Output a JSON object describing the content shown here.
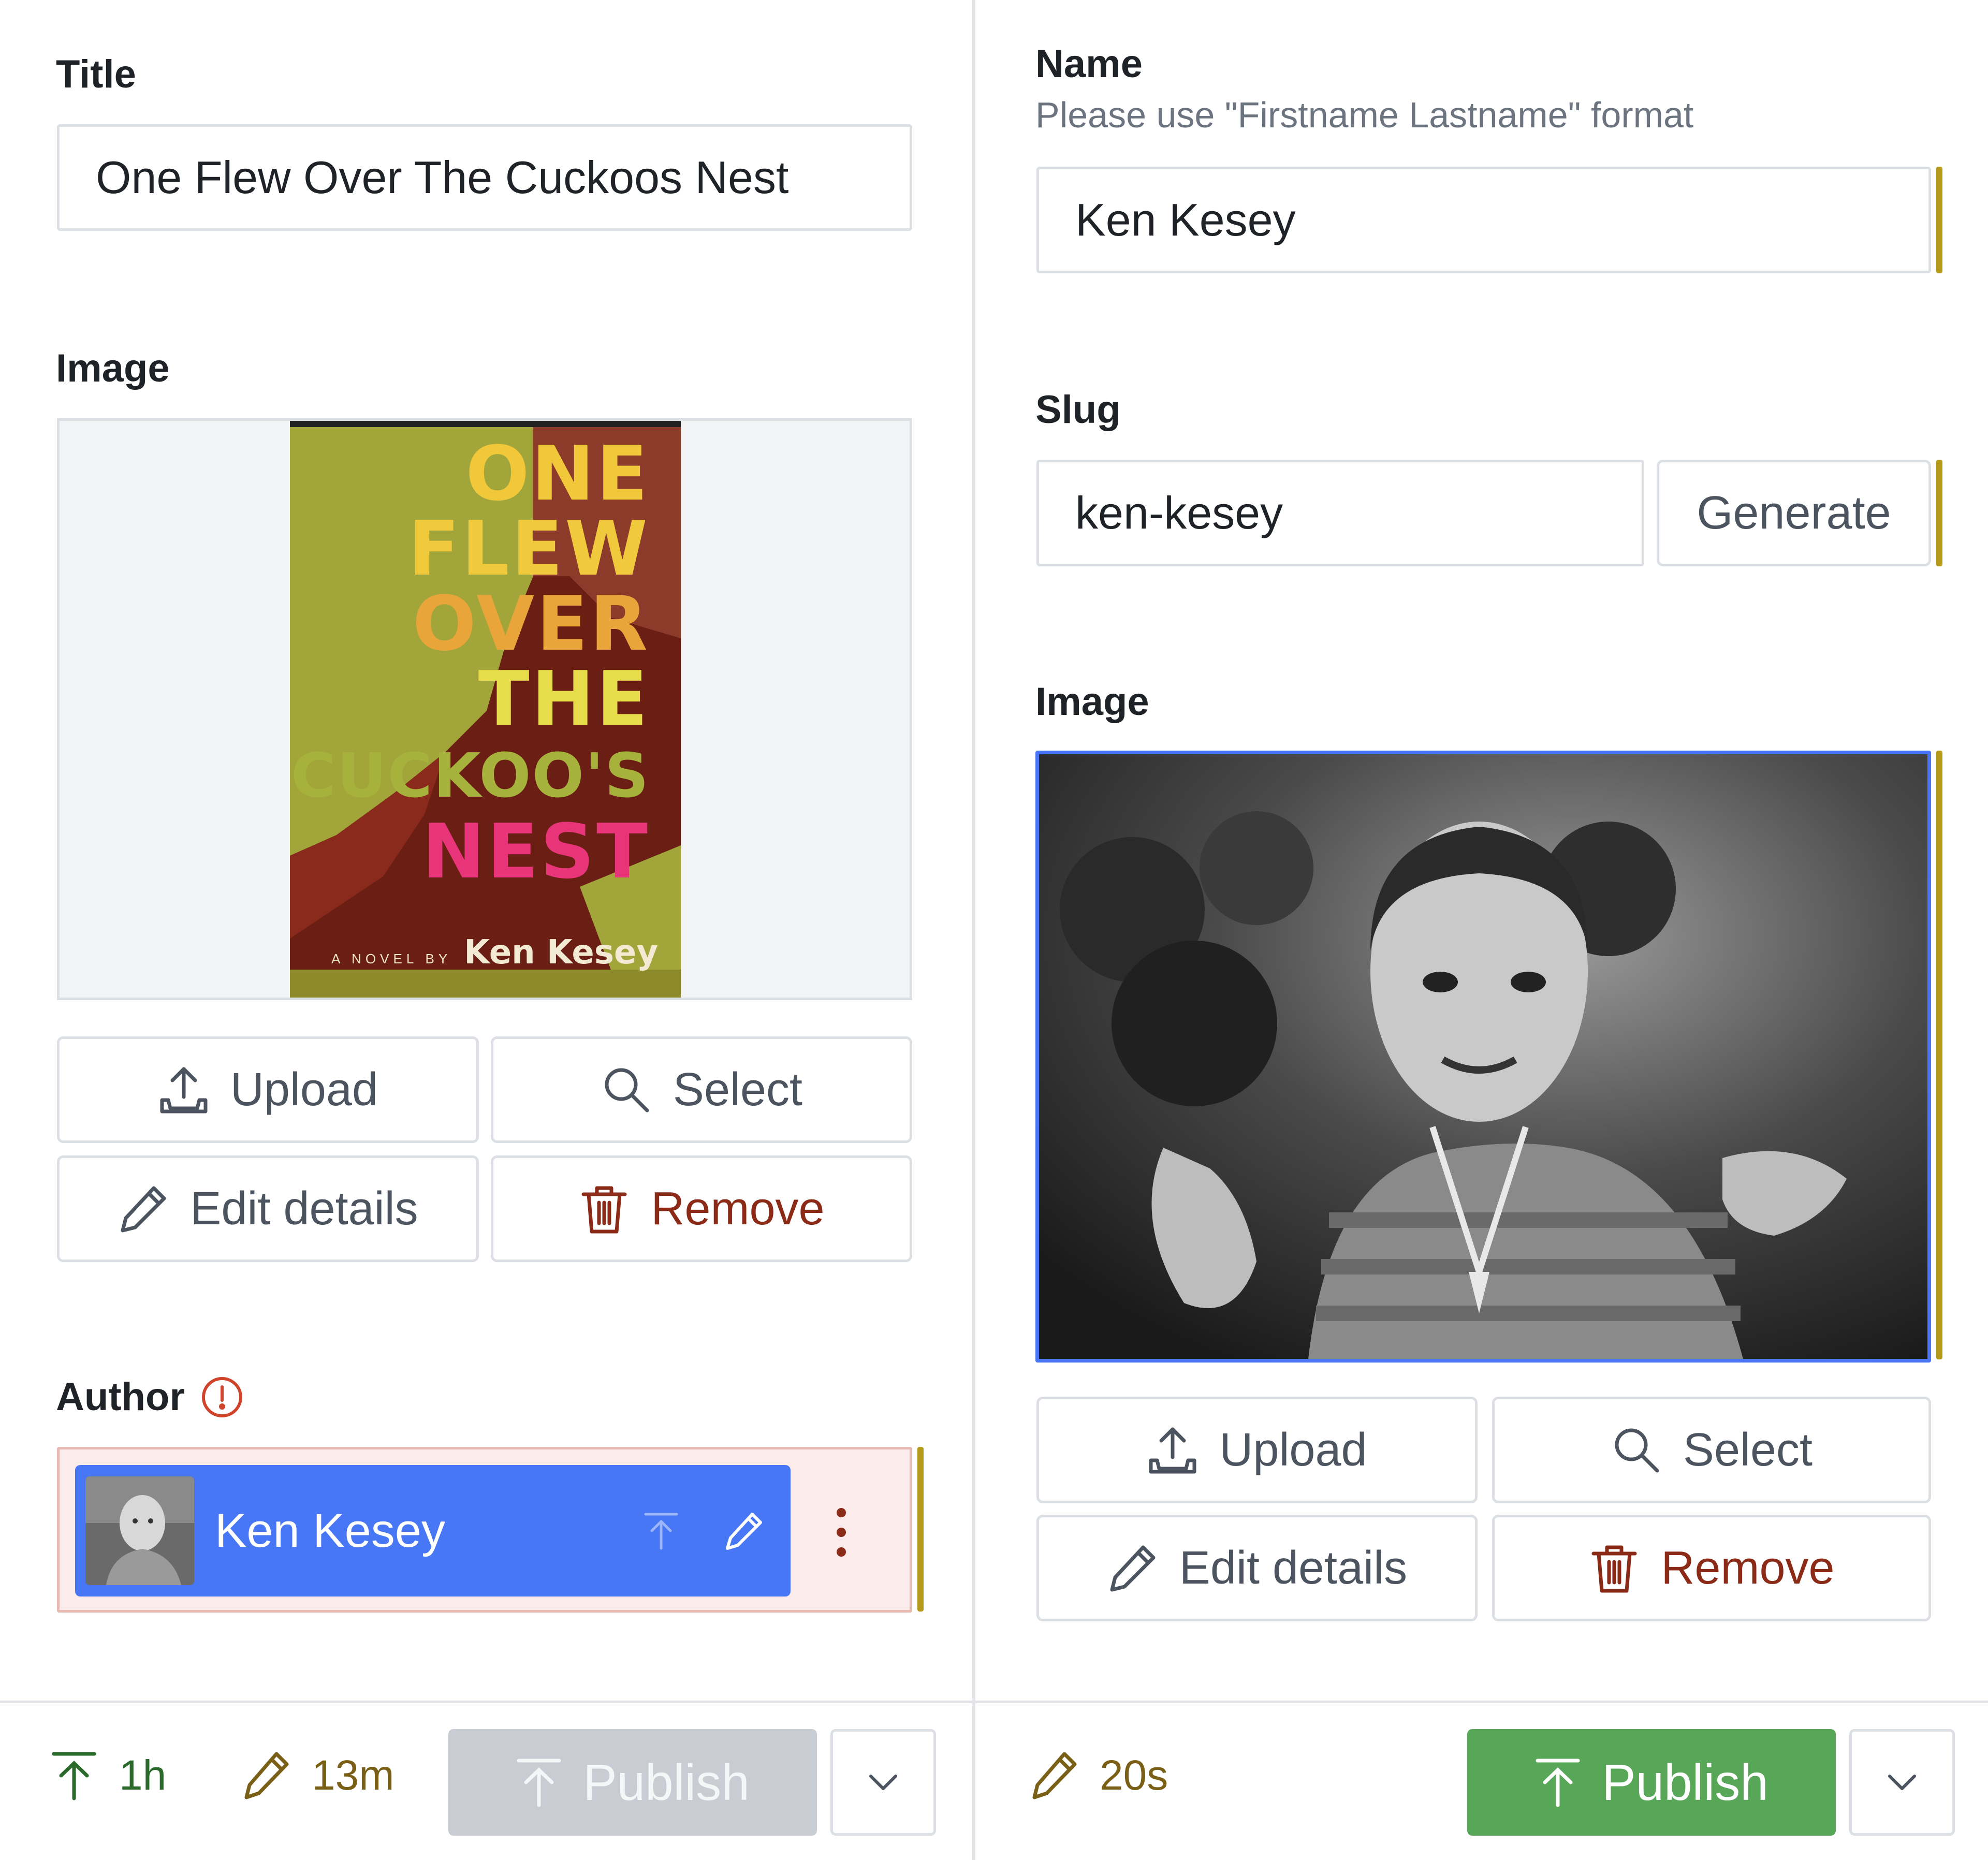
{
  "left": {
    "title_label": "Title",
    "title_value": "One Flew Over The Cuckoos Nest",
    "image_label": "Image",
    "cover": {
      "lines": [
        "ONE",
        "FLEW",
        "OVER",
        "THE",
        "CUCKOO'S",
        "NEST"
      ],
      "byline_small": "A NOVEL BY",
      "byline_name": "Ken Kesey"
    },
    "buttons": {
      "upload": "Upload",
      "select": "Select",
      "edit": "Edit details",
      "remove": "Remove"
    },
    "author_label": "Author",
    "author_chip_name": "Ken Kesey"
  },
  "right": {
    "name_label": "Name",
    "name_hint": "Please use \"Firstname Lastname\" format",
    "name_value": "Ken Kesey",
    "slug_label": "Slug",
    "slug_value": "ken-kesey",
    "generate_label": "Generate",
    "image_label": "Image",
    "buttons": {
      "upload": "Upload",
      "select": "Select",
      "edit": "Edit details",
      "remove": "Remove"
    }
  },
  "footer_left": {
    "published_ago": "1h",
    "edited_ago": "13m",
    "publish_label": "Publish"
  },
  "footer_right": {
    "edited_ago": "20s",
    "publish_label": "Publish"
  },
  "colors": {
    "change_bar": "#b59a1a",
    "focus_blue": "#4a75f5",
    "chip_blue": "#4877f6",
    "publish_green": "#58a657",
    "danger": "#8a2a17",
    "error": "#d0442b"
  }
}
